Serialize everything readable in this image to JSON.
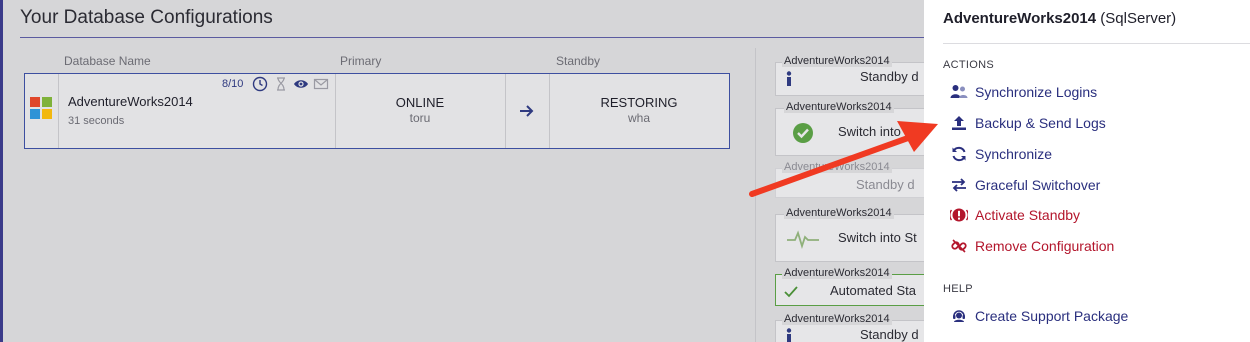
{
  "main": {
    "title": "Your Database Configurations",
    "columns": {
      "name": "Database Name",
      "primary": "Primary",
      "standby": "Standby"
    },
    "row": {
      "name": "AdventureWorks2014",
      "time": "31 seconds",
      "count": "8/10",
      "primary_status": "ONLINE",
      "primary_host": "toru",
      "standby_status": "RESTORING",
      "standby_host": "wha"
    },
    "cards": [
      {
        "label": "AdventureWorks2014",
        "text": "Standby d",
        "icon": "info-icon"
      },
      {
        "label": "AdventureWorks2014",
        "text": "Switch into",
        "icon": "check-circle-icon"
      },
      {
        "label": "AdventureWorks2014",
        "text": "Standby d",
        "icon": "none"
      },
      {
        "label": "AdventureWorks2014",
        "text": "Switch into St",
        "icon": "heartbeat-icon"
      },
      {
        "label": "AdventureWorks2014",
        "text": "Automated Sta",
        "icon": "check-icon"
      },
      {
        "label": "AdventureWorks2014",
        "text": "Standby d",
        "icon": "info-icon"
      }
    ]
  },
  "panel": {
    "title_name": "AdventureWorks2014",
    "title_type": "(SqlServer)",
    "actions_label": "ACTIONS",
    "actions": [
      {
        "label": "Synchronize Logins",
        "icon": "users-icon"
      },
      {
        "label": "Backup & Send Logs",
        "icon": "upload-icon"
      },
      {
        "label": "Synchronize",
        "icon": "sync-icon"
      },
      {
        "label": "Graceful Switchover",
        "icon": "swap-icon"
      },
      {
        "label": "Activate Standby",
        "icon": "alert-icon"
      },
      {
        "label": "Remove Configuration",
        "icon": "unlink-icon"
      }
    ],
    "help_label": "HELP",
    "help_items": [
      {
        "label": "Create Support Package",
        "icon": "support-icon"
      }
    ]
  },
  "colors": {
    "accent": "#2a2f7e",
    "danger": "#b3162c",
    "annotation_arrow": "#f03a22",
    "success": "#5a9e45"
  }
}
